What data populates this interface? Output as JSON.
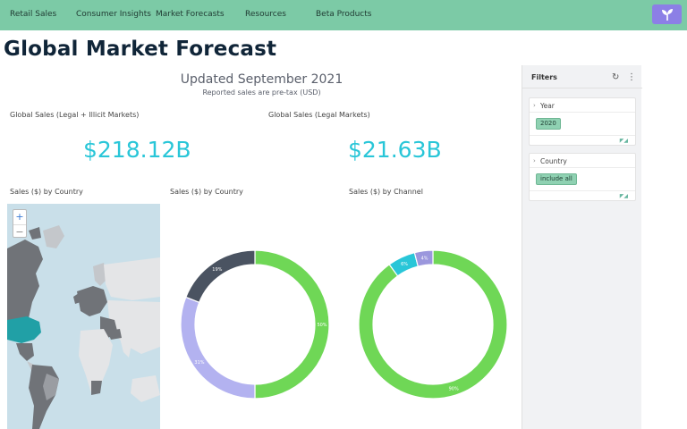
{
  "nav": {
    "items": [
      "Retail Sales",
      "Consumer Insights",
      "Market Forecasts",
      "Resources",
      "Beta Products"
    ],
    "brand_icon": "sprout-icon",
    "brand_color": "#8c7fe6",
    "bar_color": "#7ccaa6"
  },
  "page": {
    "title": "Global Market Forecast",
    "updated": "Updated September 2021",
    "subtitle": "Reported sales are pre-tax (USD)"
  },
  "kpis": [
    {
      "label": "Global Sales (Legal + Illicit Markets)",
      "value": "$218.12B"
    },
    {
      "label": "Global Sales (Legal Markets)",
      "value": "$21.63B"
    }
  ],
  "charts": {
    "map_label": "Sales ($) by Country",
    "zoom_in": "+",
    "zoom_out": "−",
    "donut1_label": "Sales ($) by Country",
    "donut2_label": "Sales ($) by Channel"
  },
  "chart_data": [
    {
      "type": "pie",
      "title": "Sales ($) by Country",
      "slices": [
        {
          "value": 50,
          "label": "50%",
          "color": "#6fd756"
        },
        {
          "value": 31,
          "label": "31%",
          "color": "#b3b2f0"
        },
        {
          "value": 19,
          "label": "19%",
          "color": "#4a5361"
        }
      ]
    },
    {
      "type": "pie",
      "title": "Sales ($) by Channel",
      "slices": [
        {
          "value": 90,
          "label": "90%",
          "color": "#6fd756"
        },
        {
          "value": 6,
          "label": "6%",
          "color": "#29c6d8"
        },
        {
          "value": 4,
          "label": "4%",
          "color": "#9b97dd"
        }
      ]
    }
  ],
  "filters": {
    "title": "Filters",
    "reset_icon": "reset-icon",
    "more_icon": "more-vertical-icon",
    "year": {
      "label": "Year",
      "value": "2020"
    },
    "country": {
      "label": "Country",
      "value": "include all"
    }
  }
}
